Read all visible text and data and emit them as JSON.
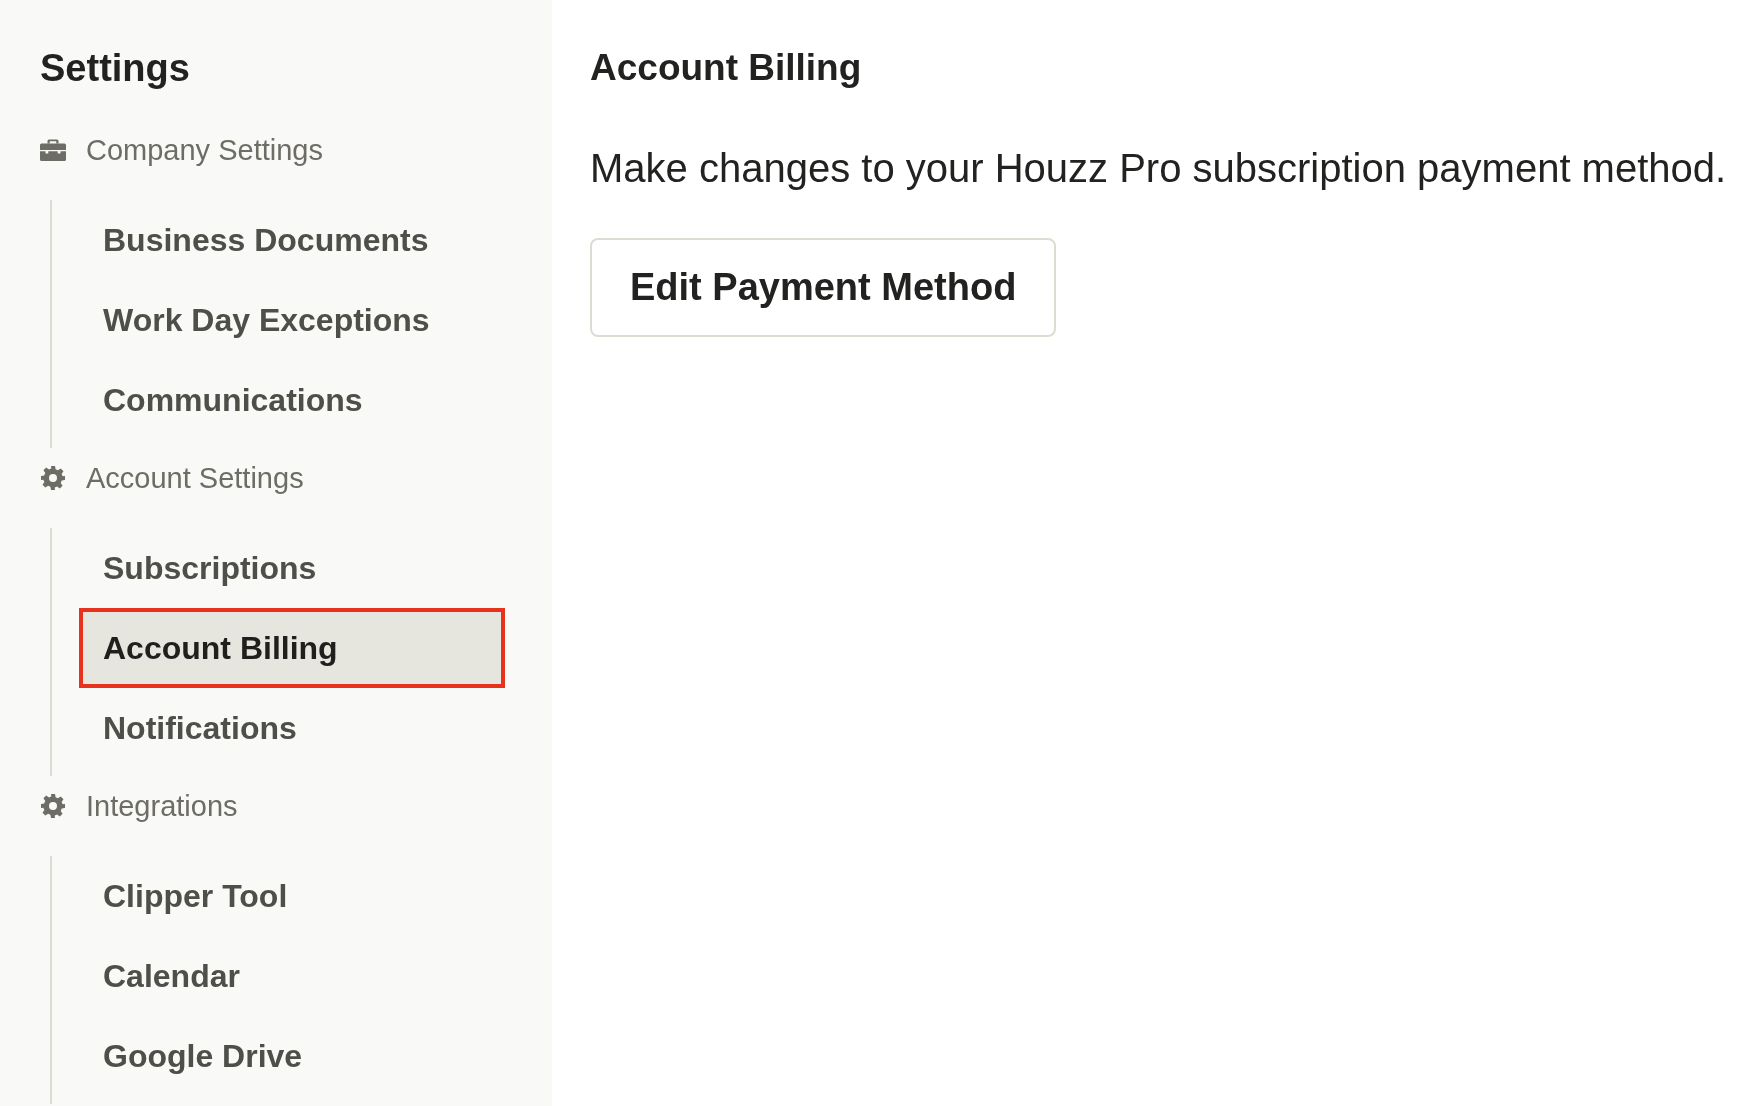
{
  "sidebar": {
    "title": "Settings",
    "sections": [
      {
        "label": "Company Settings",
        "items": [
          {
            "label": "Business Documents",
            "selected": false,
            "outlined": false
          },
          {
            "label": "Work Day Exceptions",
            "selected": false,
            "outlined": false
          },
          {
            "label": "Communications",
            "selected": false,
            "outlined": false
          }
        ]
      },
      {
        "label": "Account Settings",
        "items": [
          {
            "label": "Subscriptions",
            "selected": false,
            "outlined": false
          },
          {
            "label": "Account Billing",
            "selected": true,
            "outlined": true
          },
          {
            "label": "Notifications",
            "selected": false,
            "outlined": false
          }
        ]
      },
      {
        "label": "Integrations",
        "items": [
          {
            "label": "Clipper Tool",
            "selected": false,
            "outlined": false
          },
          {
            "label": "Calendar",
            "selected": false,
            "outlined": false
          },
          {
            "label": "Google Drive",
            "selected": false,
            "outlined": false
          }
        ]
      }
    ]
  },
  "main": {
    "title": "Account Billing",
    "description": "Make changes to your Houzz Pro subscription payment method.",
    "button": "Edit Payment Method"
  }
}
